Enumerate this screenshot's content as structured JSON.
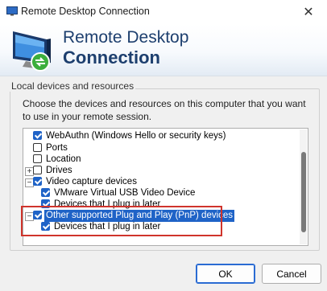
{
  "window": {
    "title": "Remote Desktop Connection"
  },
  "banner": {
    "line1": "Remote Desktop",
    "line2": "Connection"
  },
  "group": {
    "title": "Local devices and resources",
    "description": "Choose the devices and resources on this computer that you want to use in your remote session."
  },
  "tree": {
    "items": [
      {
        "label": "WebAuthn (Windows Hello or security keys)",
        "checked": true
      },
      {
        "label": "Ports",
        "checked": false
      },
      {
        "label": "Location",
        "checked": false
      },
      {
        "label": "Drives",
        "checked": false,
        "expander": "+"
      },
      {
        "label": "Video capture devices",
        "checked": true,
        "expander": "−"
      },
      {
        "label": "VMware Virtual USB Video Device",
        "checked": true
      },
      {
        "label": "Devices that I plug in later",
        "checked": true
      },
      {
        "label": "Other supported Plug and Play (PnP) devices",
        "checked": true,
        "expander": "−",
        "selected": true
      },
      {
        "label": "Devices that I plug in later",
        "checked": true
      }
    ]
  },
  "buttons": {
    "ok": "OK",
    "cancel": "Cancel"
  },
  "icons": {
    "app": "remote-desktop-icon",
    "close": "close-icon"
  },
  "colors": {
    "selection": "#1f63c7",
    "highlight": "#d0342c",
    "banner_text": "#1d3f6e"
  }
}
